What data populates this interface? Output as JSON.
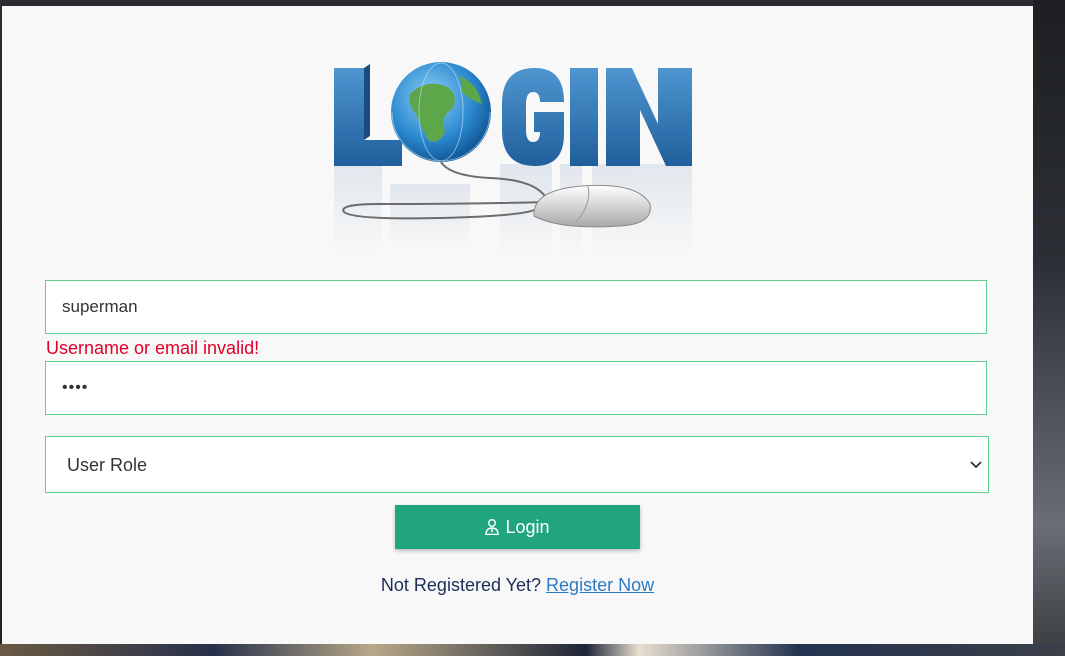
{
  "form": {
    "username_value": "superman",
    "password_value": "••••",
    "error_message": "Username or email invalid!",
    "role_selected": "User Role",
    "login_label": "Login"
  },
  "footer": {
    "prompt": "Not Registered Yet?",
    "register_link": "Register Now"
  },
  "colors": {
    "accent": "#20a57e",
    "field_border": "#5fcf8f",
    "error": "#e0002a",
    "link": "#2b7bc4"
  },
  "icons": {
    "logo": "login-globe-mouse-logo",
    "login_button": "user-tie-icon",
    "select": "chevron-down-icon"
  }
}
